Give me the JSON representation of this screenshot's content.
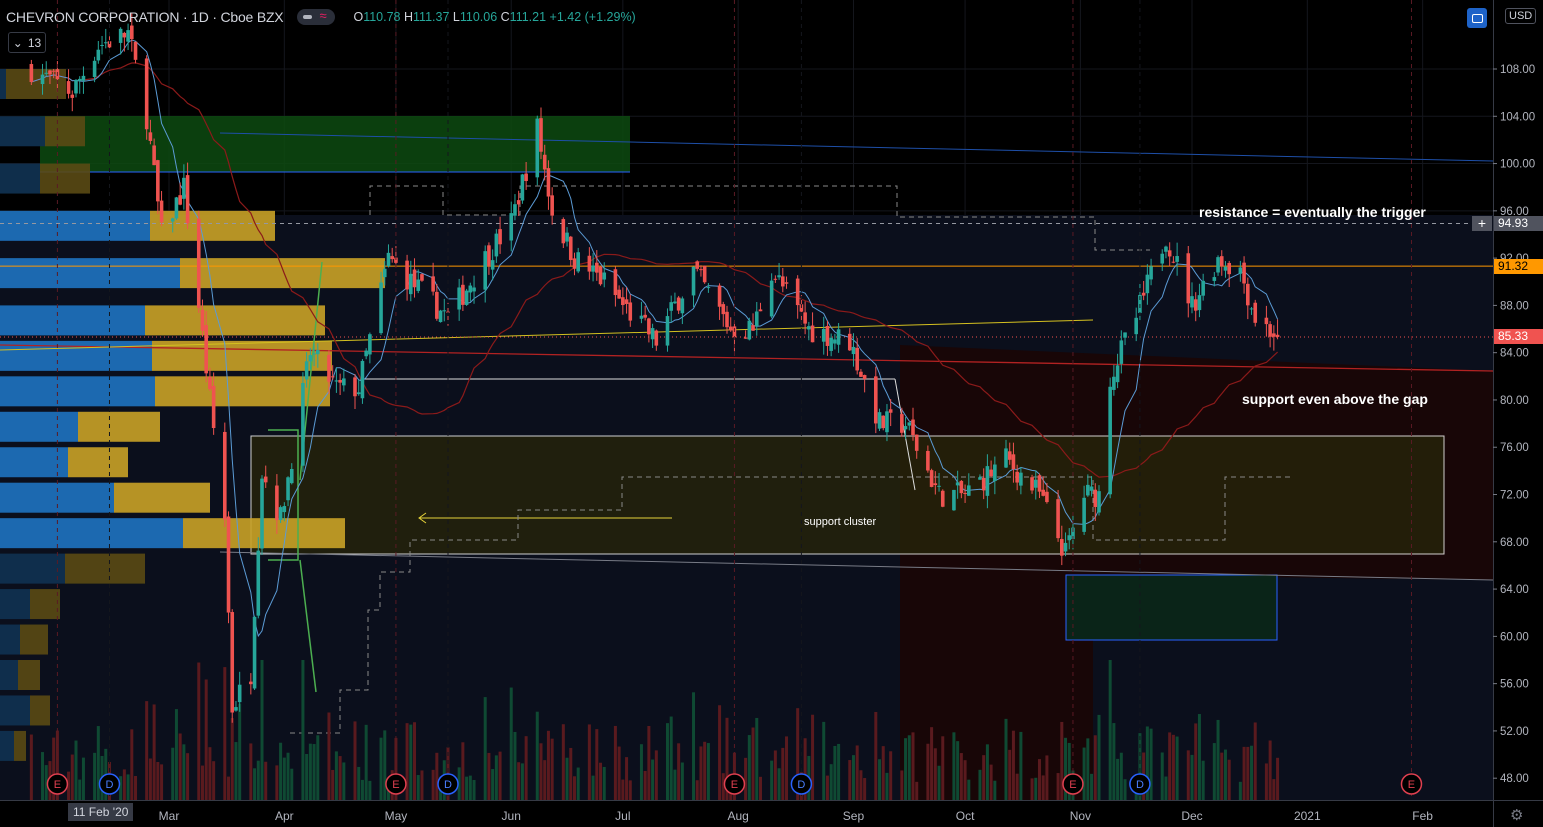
{
  "header": {
    "symbol": "CHEVRON CORPORATION · 1D · Cboe BZX",
    "open_label": "O",
    "open": "110.78",
    "high_label": "H",
    "high": "111.37",
    "low_label": "L",
    "low": "110.06",
    "close_label": "C",
    "close": "111.21",
    "change": "+1.42 (+1.29%)",
    "indicators_count": "13",
    "currency": "USD"
  },
  "price_tags": {
    "crosshair": "94.93",
    "level": "91.32",
    "last": "85.33"
  },
  "crosshair_date": "11 Feb '20",
  "annotations": {
    "resistance": "resistance = eventually the trigger",
    "support_gap": "support even above the gap",
    "support_cluster": "support cluster"
  },
  "colors": {
    "up": "#26a69a",
    "down": "#ef5350",
    "level": "#ff9800",
    "last": "#f05350",
    "bg": "#000000"
  },
  "chart_data": {
    "type": "candlestick",
    "title": "CHEVRON CORPORATION · 1D · Cboe BZX",
    "ylim": [
      46,
      112
    ],
    "y_ticks": [
      "108.00",
      "104.00",
      "100.00",
      "96.00",
      "92.00",
      "88.00",
      "84.00",
      "80.00",
      "76.00",
      "72.00",
      "68.00",
      "64.00",
      "60.00",
      "56.00",
      "52.00",
      "48.00"
    ],
    "x_ticks": [
      {
        "label": "Mar",
        "date": "2020-03-01"
      },
      {
        "label": "Apr",
        "date": "2020-04-01"
      },
      {
        "label": "May",
        "date": "2020-05-01"
      },
      {
        "label": "Jun",
        "date": "2020-06-01"
      },
      {
        "label": "Jul",
        "date": "2020-07-01"
      },
      {
        "label": "Aug",
        "date": "2020-08-01"
      },
      {
        "label": "Sep",
        "date": "2020-09-01"
      },
      {
        "label": "Oct",
        "date": "2020-10-01"
      },
      {
        "label": "Nov",
        "date": "2020-11-01"
      },
      {
        "label": "Dec",
        "date": "2020-12-01"
      },
      {
        "label": "2021",
        "date": "2021-01-01"
      },
      {
        "label": "Feb",
        "date": "2021-02-01"
      }
    ],
    "close_path": [
      [
        "2020-01-24",
        108
      ],
      [
        "2020-02-04",
        106
      ],
      [
        "2020-02-11",
        110
      ],
      [
        "2020-02-19",
        111
      ],
      [
        "2020-02-24",
        104
      ],
      [
        "2020-02-28",
        94
      ],
      [
        "2020-03-05",
        98
      ],
      [
        "2020-03-09",
        88
      ],
      [
        "2020-03-12",
        80
      ],
      [
        "2020-03-16",
        70
      ],
      [
        "2020-03-18",
        54
      ],
      [
        "2020-03-23",
        57
      ],
      [
        "2020-03-26",
        74
      ],
      [
        "2020-03-31",
        70
      ],
      [
        "2020-04-08",
        84
      ],
      [
        "2020-04-15",
        81
      ],
      [
        "2020-04-21",
        81
      ],
      [
        "2020-04-29",
        92
      ],
      [
        "2020-05-05",
        90
      ],
      [
        "2020-05-15",
        87
      ],
      [
        "2020-05-25",
        92
      ],
      [
        "2020-06-01",
        95
      ],
      [
        "2020-06-08",
        103
      ],
      [
        "2020-06-12",
        96
      ],
      [
        "2020-06-18",
        92
      ],
      [
        "2020-06-26",
        90
      ],
      [
        "2020-07-01",
        88
      ],
      [
        "2020-07-10",
        85
      ],
      [
        "2020-07-20",
        91
      ],
      [
        "2020-07-30",
        86
      ],
      [
        "2020-08-05",
        86
      ],
      [
        "2020-08-10",
        91
      ],
      [
        "2020-08-20",
        86
      ],
      [
        "2020-08-31",
        85
      ],
      [
        "2020-09-08",
        78
      ],
      [
        "2020-09-15",
        78
      ],
      [
        "2020-09-24",
        72
      ],
      [
        "2020-10-01",
        72
      ],
      [
        "2020-10-12",
        75
      ],
      [
        "2020-10-21",
        72
      ],
      [
        "2020-10-28",
        67
      ],
      [
        "2020-11-02",
        72
      ],
      [
        "2020-11-06",
        72
      ],
      [
        "2020-11-09",
        82
      ],
      [
        "2020-11-16",
        87
      ],
      [
        "2020-11-24",
        94
      ],
      [
        "2020-12-01",
        88
      ],
      [
        "2020-12-08",
        92
      ],
      [
        "2020-12-14",
        91
      ],
      [
        "2020-12-18",
        87
      ],
      [
        "2020-12-24",
        85.33
      ]
    ],
    "events": [
      {
        "type": "E",
        "date": "2020-01-31"
      },
      {
        "type": "D",
        "date": "2020-02-14"
      },
      {
        "type": "E",
        "date": "2020-05-01"
      },
      {
        "type": "D",
        "date": "2020-05-15"
      },
      {
        "type": "E",
        "date": "2020-07-31"
      },
      {
        "type": "D",
        "date": "2020-08-18"
      },
      {
        "type": "E",
        "date": "2020-10-30"
      },
      {
        "type": "D",
        "date": "2020-11-17"
      },
      {
        "type": "E",
        "date": "2021-01-29"
      }
    ],
    "horizontal_levels": [
      91.32,
      94.93
    ]
  }
}
